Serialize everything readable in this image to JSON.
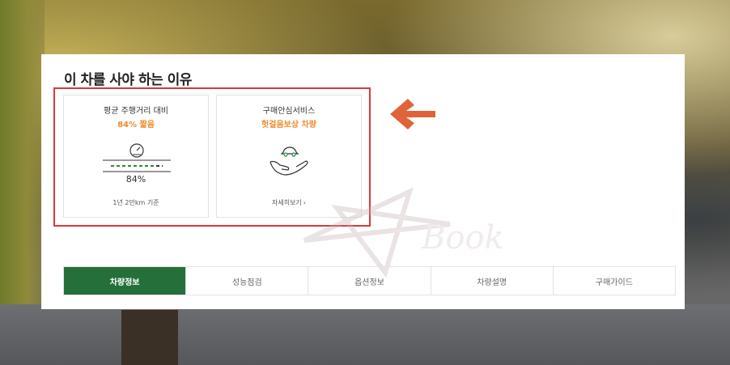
{
  "section": {
    "title": "이 차를 사야 하는 이유"
  },
  "cards": [
    {
      "heading": "평균 주행거리 대비",
      "highlight": "84% 짧음",
      "value": "84%",
      "footer": "1년 2만km 기준",
      "icon": "speedometer-icon"
    },
    {
      "heading": "구매안심서비스",
      "highlight": "헛걸음보상 차량",
      "link": "자세히보기",
      "icon": "car-in-hand-icon"
    }
  ],
  "tabs": [
    {
      "label": "차량정보",
      "active": true
    },
    {
      "label": "성능점검",
      "active": false
    },
    {
      "label": "옵션정보",
      "active": false
    },
    {
      "label": "차량설명",
      "active": false
    },
    {
      "label": "구매가이드",
      "active": false
    }
  ],
  "watermark": {
    "text": "Book"
  },
  "colors": {
    "accent_orange": "#f08a2c",
    "tab_active": "#25703a",
    "highlight_border": "#d8393a",
    "arrow": "#e0643a"
  }
}
